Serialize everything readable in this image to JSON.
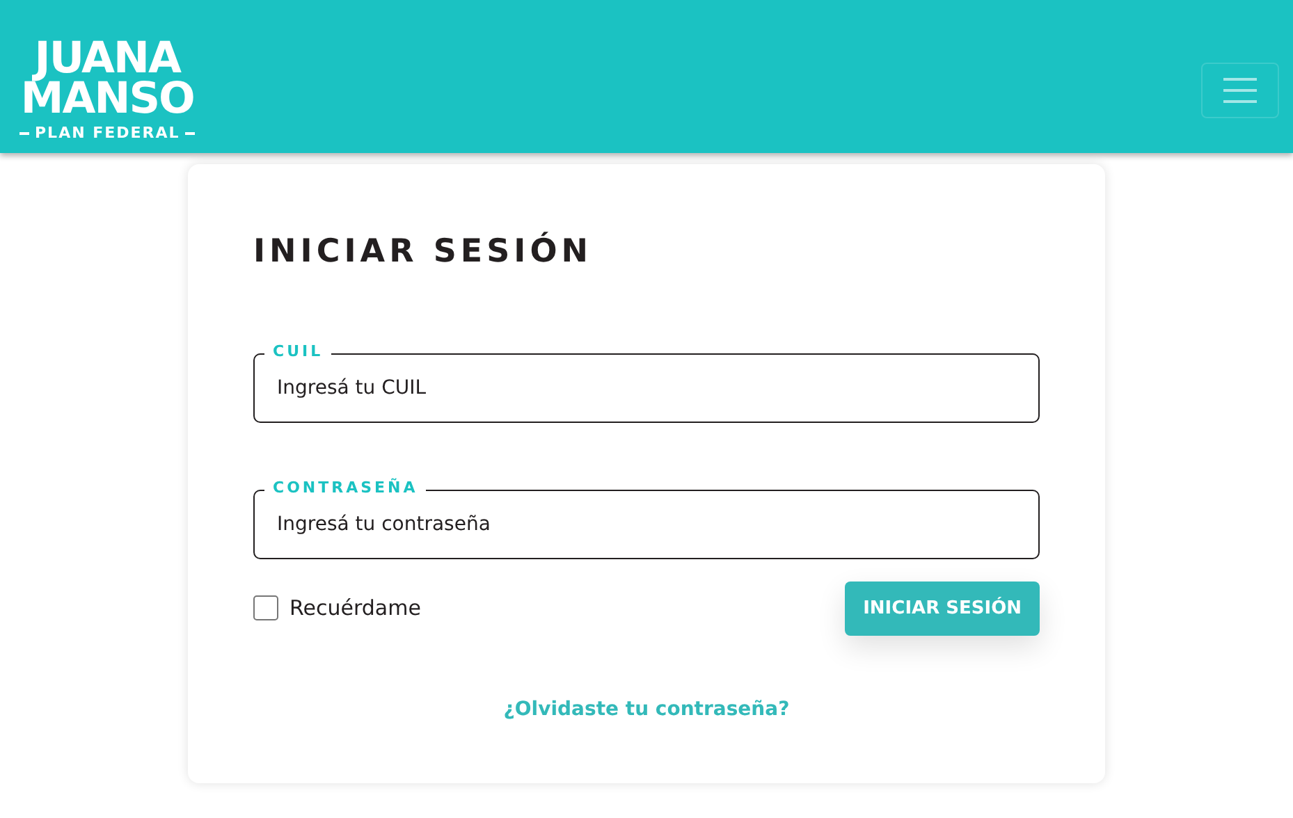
{
  "logo": {
    "line_1": "JUANA",
    "line_2": "MANSO",
    "tagline": "PLAN FEDERAL"
  },
  "title": "INICIAR SESIÓN",
  "fields": [
    {
      "label": "CUIL",
      "placeholder": "Ingresá tu CUIL"
    },
    {
      "label": "CONTRASEÑA",
      "placeholder": "Ingresá tu contraseña"
    }
  ],
  "remember": {
    "label": "Recuérdame",
    "checked": false
  },
  "submit": "INICIAR SESIÓN",
  "forgot_link": "¿Olvidaste tu contraseña?"
}
